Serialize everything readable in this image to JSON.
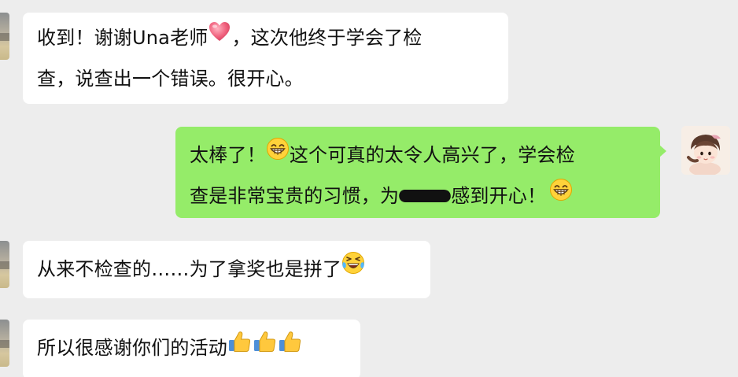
{
  "chat": {
    "messages": [
      {
        "side": "left",
        "lines": [
          {
            "before": "收到！谢谢Una老师",
            "emoji": "heart-icon",
            "after": "，这次他终于学会了检"
          },
          {
            "text": "查，说查出一个错误。很开心。"
          }
        ]
      },
      {
        "side": "right",
        "lines": [
          {
            "before": "太棒了！",
            "emoji": "grinning-face-icon",
            "after": "这个可真的太令人高兴了，学会检"
          },
          {
            "before": "查是非常宝贵的习惯，为",
            "redacted": "redacted-name",
            "after": "感到开心！",
            "emoji_end": "grinning-face-icon"
          }
        ]
      },
      {
        "side": "left",
        "lines": [
          {
            "text": "从来不检查的……为了拿奖也是拼了",
            "emoji_end": "laughing-tears-icon"
          }
        ]
      },
      {
        "side": "left",
        "lines": [
          {
            "text": "所以很感谢你们的活动",
            "emoji_end": "thumbs-up-icon x3"
          }
        ]
      }
    ]
  },
  "colors": {
    "background": "#ededed",
    "bubble_white": "#ffffff",
    "bubble_green": "#95ec69",
    "text": "#111111"
  }
}
